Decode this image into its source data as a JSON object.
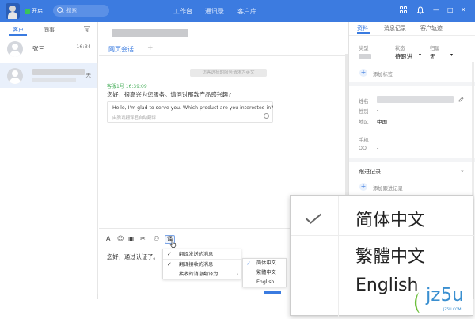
{
  "topbar": {
    "status": "开启",
    "search_placeholder": "搜索",
    "nav": [
      "工作台",
      "通讯录",
      "客户库"
    ],
    "active_nav": "工作台",
    "window_controls": [
      "—",
      "□",
      "✕"
    ]
  },
  "left": {
    "tabs": [
      "客户",
      "同事"
    ],
    "contacts": [
      {
        "name": "张三",
        "time": "16:34"
      },
      {
        "name": "",
        "time": "天"
      }
    ]
  },
  "chat": {
    "tabs": [
      "网页会话",
      "+"
    ],
    "system_message": "访客选择的服务请求为英文",
    "agent_label": "客服1号 16:39:09",
    "message_text": "您好，很高兴为您服务。请问对那款产品感兴趣?",
    "translation": "Hello, I'm glad to serve you. Which product are you interested in?",
    "translation_note": "由腾讯翻译君自动翻译",
    "toolbar": [
      "A",
      "☺",
      "▣",
      "✂",
      "⚇"
    ],
    "translate_button": "译",
    "input_text": "您好，通过认证了。"
  },
  "translate_menu": {
    "items": [
      {
        "label": "翻译发送的消息",
        "checked": true
      },
      {
        "label": "翻译接收的消息",
        "checked": true
      },
      {
        "label": "接收的消息翻译为",
        "submenu": true
      }
    ],
    "submenu_arrow": "›",
    "languages": [
      {
        "label": "简体中文",
        "checked": true
      },
      {
        "label": "繁體中文",
        "checked": false
      },
      {
        "label": "English",
        "checked": false
      }
    ],
    "check_glyph": "✓"
  },
  "right": {
    "tabs": [
      "资料",
      "消息记录",
      "客户轨迹"
    ],
    "type_label": "类型",
    "status_label": "状态",
    "status_value": "待跟进",
    "owner_label": "归属",
    "owner_value": "无",
    "add_tag": "添加标签",
    "name_label": "姓名",
    "gender_label": "性别",
    "gender_value": "-",
    "region_label": "地区",
    "region_value": "中国",
    "phone_label": "手机",
    "phone_value": "-",
    "qq_label": "QQ",
    "qq_value": "-",
    "followup_title": "跟进记录",
    "add_followup": "添加跟进记录"
  },
  "zoom": {
    "languages": [
      "简体中文",
      "繁體中文",
      "English"
    ]
  },
  "watermark": {
    "text": "jz5u",
    "sub": "JZ5U.COM"
  },
  "colors": {
    "accent": "#3c7be0",
    "agent_green": "#4bb05e",
    "online": "#39c45a"
  }
}
